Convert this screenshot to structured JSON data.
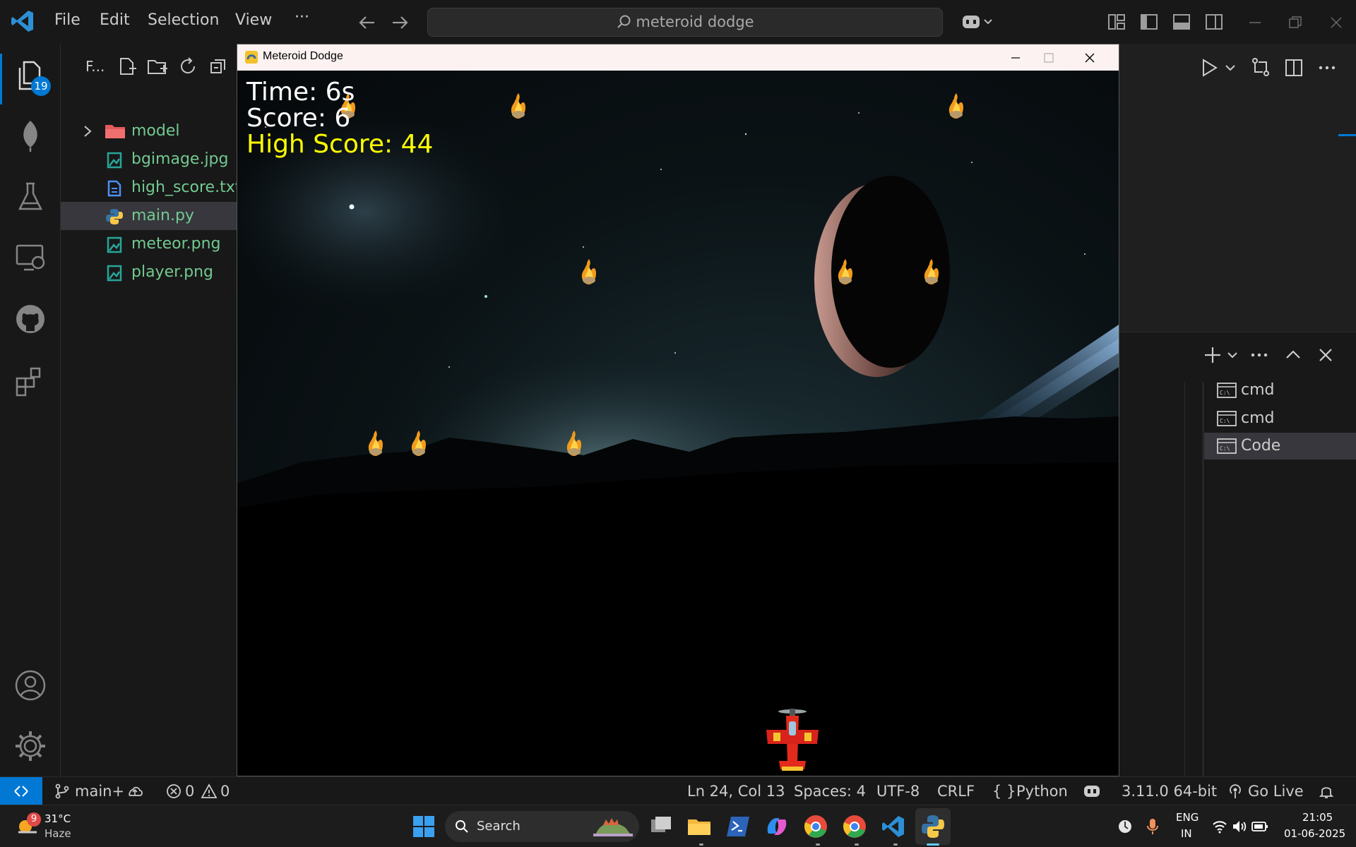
{
  "menu": {
    "file": "File",
    "edit": "Edit",
    "selection": "Selection",
    "view": "View",
    "more": "···"
  },
  "search": {
    "text": "meteroid dodge"
  },
  "activity": {
    "explorer_badge": "19"
  },
  "explorer": {
    "title": "F...",
    "files": [
      {
        "name": "model",
        "type": "folder"
      },
      {
        "name": "bgimage.jpg",
        "type": "image"
      },
      {
        "name": "high_score.txt",
        "type": "text"
      },
      {
        "name": "main.py",
        "type": "python"
      },
      {
        "name": "meteor.png",
        "type": "image"
      },
      {
        "name": "player.png",
        "type": "image"
      }
    ]
  },
  "game_window": {
    "title": "Meteroid Dodge",
    "hud": {
      "time": "Time: 6s",
      "score": "Score: 6",
      "high_score": "High Score: 44"
    }
  },
  "terminal": {
    "items": [
      "cmd",
      "cmd",
      "Code"
    ],
    "selected_index": 2
  },
  "statusbar": {
    "branch": "main+",
    "errors": "0",
    "warnings": "0",
    "position": "Ln 24, Col 13",
    "spaces": "Spaces: 4",
    "encoding": "UTF-8",
    "eol": "CRLF",
    "language": "Python",
    "interpreter": "3.11.0 64-bit",
    "go_live": "Go Live"
  },
  "taskbar": {
    "weather_temp": "31°C",
    "weather_desc": "Haze",
    "weather_badge": "9",
    "search_label": "Search",
    "lang_top": "ENG",
    "lang_bottom": "IN",
    "time": "21:05",
    "date": "01-06-2025"
  },
  "colors": {
    "accent": "#0078d4",
    "file_green": "#73c991",
    "folder_red": "#e35a5a",
    "hud_white": "#ffffff",
    "hud_yellow": "#ffff00"
  }
}
